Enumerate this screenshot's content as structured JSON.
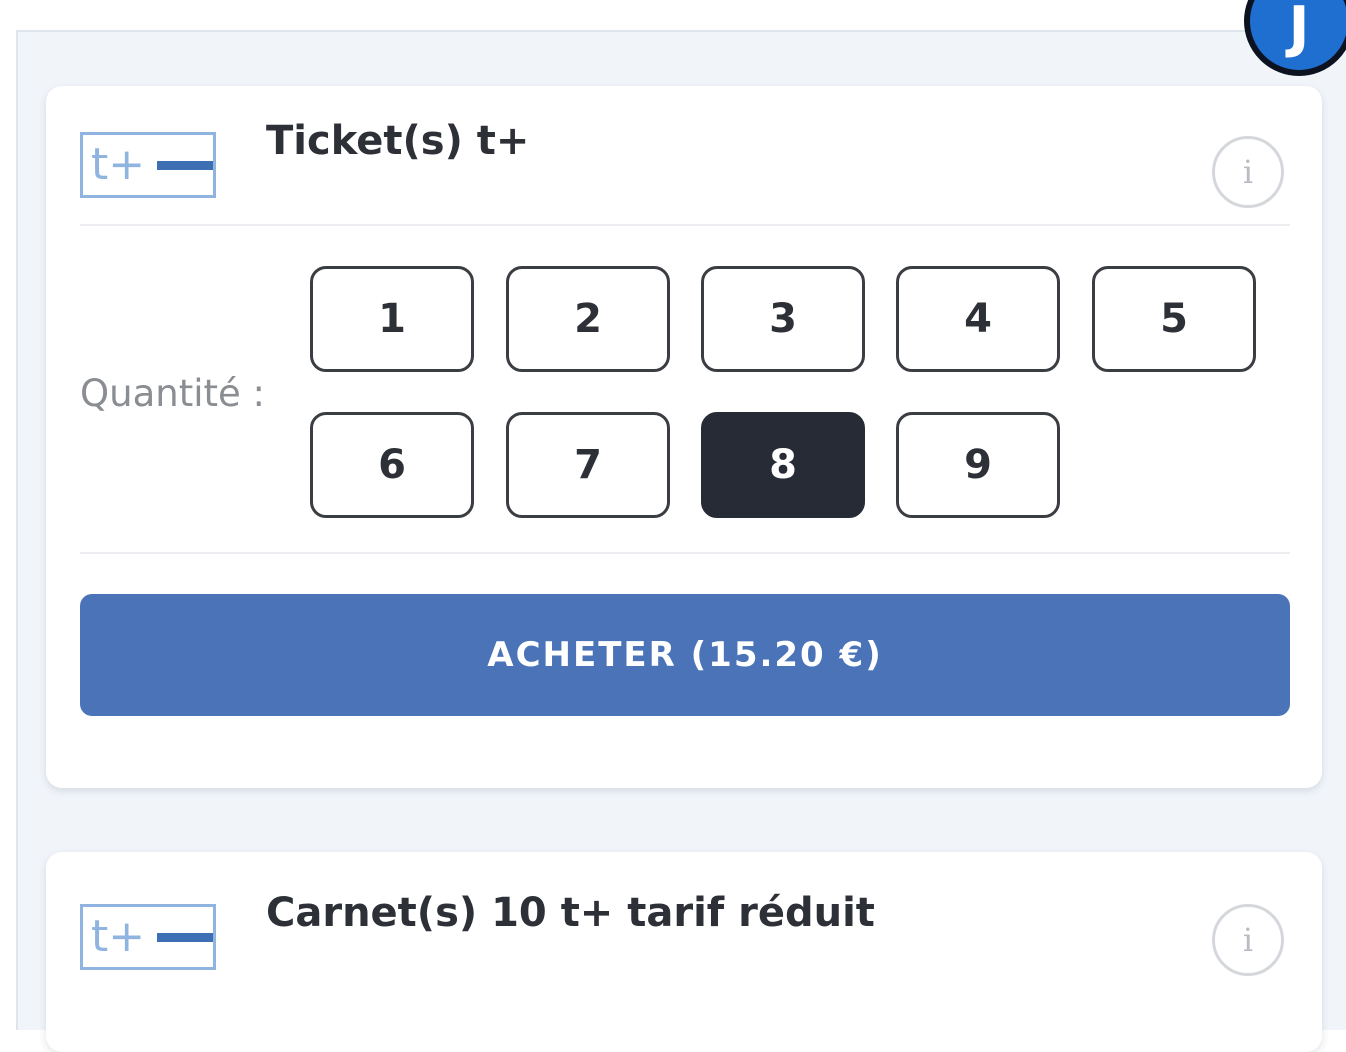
{
  "avatar": {
    "initial": "J"
  },
  "products": [
    {
      "logo_text": "t+",
      "title": "Ticket(s) t+",
      "info_symbol": "i"
    },
    {
      "logo_text": "t+",
      "title": "Carnet(s) 10 t+ tarif réduit",
      "info_symbol": "i"
    }
  ],
  "quantity": {
    "label": "Quantité :",
    "options": [
      "1",
      "2",
      "3",
      "4",
      "5",
      "6",
      "7",
      "8",
      "9"
    ],
    "selected": "8"
  },
  "buy_button": {
    "label": "ACHETER (15.20 €)"
  },
  "colors": {
    "accent": "#4a73b8",
    "selected_bg": "#262b35",
    "logo_blue": "#8fb4df",
    "avatar_blue": "#1f6fd0"
  },
  "icons": {
    "info": "info-icon",
    "product_logo": "ticket-t-plus-logo"
  }
}
